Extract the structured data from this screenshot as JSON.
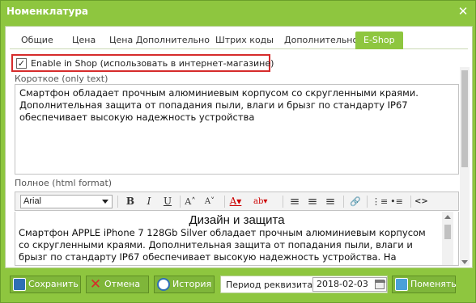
{
  "window": {
    "title": "Номенклатура",
    "close_glyph": "✕"
  },
  "tabs": [
    {
      "label": "Общие"
    },
    {
      "label": "Цена"
    },
    {
      "label": "Цена Дополнительно"
    },
    {
      "label": "Штрих коды"
    },
    {
      "label": "Дополнительно"
    },
    {
      "label": "E-Shop",
      "active": true
    }
  ],
  "shop": {
    "enable_label": "Enable in Shop (использовать в интернет-магазине)",
    "checked": true,
    "check_glyph": "✓"
  },
  "short_desc": {
    "label": "Короткое (only text)",
    "text": "Смартфон обладает прочным алюминиевым корпусом со скругленными краями. Дополнительная защита от попадания пыли, влаги и брызг по стандарту IP67 обеспечивает высокую надежность устройства"
  },
  "full_desc": {
    "label": "Полное (html format)",
    "heading": "Дизайн и защита",
    "body": "Смартфон APPLE iPhone 7 128Gb Silver обладает прочным алюминиевым корпусом со скругленными краями. Дополнительная защита от попадания пыли, влаги и брызг по стандарту IP67 обеспечивает высокую надежность устройства. На фронтальной панели"
  },
  "editor_toolbar": {
    "font": "Arial",
    "buttons": [
      {
        "name": "bold-button",
        "glyph": "B"
      },
      {
        "name": "italic-button",
        "glyph": "I"
      },
      {
        "name": "underline-button",
        "glyph": "U"
      },
      {
        "name": "font-size-increase-button",
        "glyph": "A˄"
      },
      {
        "name": "font-size-decrease-button",
        "glyph": "A˅"
      },
      {
        "name": "text-color-button",
        "glyph": "A▾"
      },
      {
        "name": "highlight-color-button",
        "glyph": "ab▾"
      },
      {
        "name": "align-left-button",
        "glyph": "≡"
      },
      {
        "name": "align-center-button",
        "glyph": "≡"
      },
      {
        "name": "align-right-button",
        "glyph": "≡"
      },
      {
        "name": "link-button",
        "glyph": "🔗"
      },
      {
        "name": "ordered-list-button",
        "glyph": "⋮≡"
      },
      {
        "name": "unordered-list-button",
        "glyph": "•≡"
      },
      {
        "name": "source-code-button",
        "glyph": "<>"
      }
    ]
  },
  "footer": {
    "save_label": "Сохранить",
    "cancel_label": "Отмена",
    "history_label": "История",
    "period_label": "Период реквизита:",
    "period_value": "2018-02-03",
    "change_label": "Поменять"
  },
  "colors": {
    "accent": "#8ec63f",
    "highlight_border": "#d62b2b",
    "cancel_icon": "#d62b2b",
    "save_icon": "#2f6fb5"
  }
}
